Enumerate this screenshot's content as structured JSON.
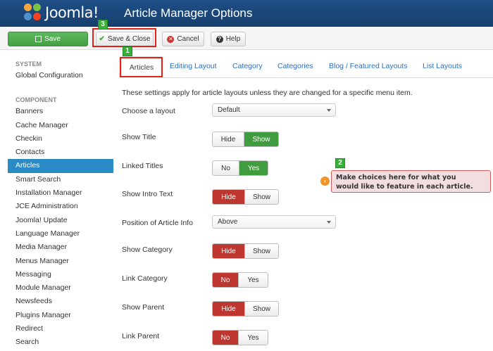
{
  "header": {
    "brand": "Joomla!",
    "title": "Article Manager Options"
  },
  "toolbar": {
    "save_label": "Save",
    "save_close_label": "Save & Close",
    "cancel_label": "Cancel",
    "help_label": "Help"
  },
  "markers": {
    "one": "1",
    "two": "2",
    "three": "3"
  },
  "sidebar": {
    "system_heading": "SYSTEM",
    "system_items": [
      "Global Configuration"
    ],
    "component_heading": "COMPONENT",
    "items": [
      "Banners",
      "Cache Manager",
      "Checkin",
      "Contacts",
      "Articles",
      "Smart Search",
      "Installation Manager",
      "JCE Administration",
      "Joomla! Update",
      "Language Manager",
      "Media Manager",
      "Menus Manager",
      "Messaging",
      "Module Manager",
      "Newsfeeds",
      "Plugins Manager",
      "Redirect",
      "Search"
    ],
    "active": "Articles"
  },
  "tabs": [
    "Articles",
    "Editing Layout",
    "Category",
    "Categories",
    "Blog / Featured Layouts",
    "List Layouts"
  ],
  "form": {
    "intro": "These settings apply for article layouts unless they are changed for a specific menu item.",
    "choose_layout": {
      "label": "Choose a layout",
      "value": "Default"
    },
    "show_title": {
      "label": "Show Title",
      "options": [
        "Hide",
        "Show"
      ],
      "selected": "Show"
    },
    "linked_titles": {
      "label": "Linked Titles",
      "options": [
        "No",
        "Yes"
      ],
      "selected": "Yes"
    },
    "show_intro": {
      "label": "Show Intro Text",
      "options": [
        "Hide",
        "Show"
      ],
      "selected": "Hide"
    },
    "position_info": {
      "label": "Position of Article Info",
      "value": "Above"
    },
    "show_category": {
      "label": "Show Category",
      "options": [
        "Hide",
        "Show"
      ],
      "selected": "Hide"
    },
    "link_category": {
      "label": "Link Category",
      "options": [
        "No",
        "Yes"
      ],
      "selected": "No"
    },
    "show_parent": {
      "label": "Show Parent",
      "options": [
        "Hide",
        "Show"
      ],
      "selected": "Hide"
    },
    "link_parent": {
      "label": "Link Parent",
      "options": [
        "No",
        "Yes"
      ],
      "selected": "No"
    }
  },
  "callout": {
    "line1": "Make choices here for what you",
    "line2": "would like to feature in each article."
  },
  "colors": {
    "header": "#1e4f86",
    "active_blue": "#2a8ac6",
    "green": "#3f9c3f",
    "red": "#bd362f",
    "highlight": "#e2231a"
  }
}
